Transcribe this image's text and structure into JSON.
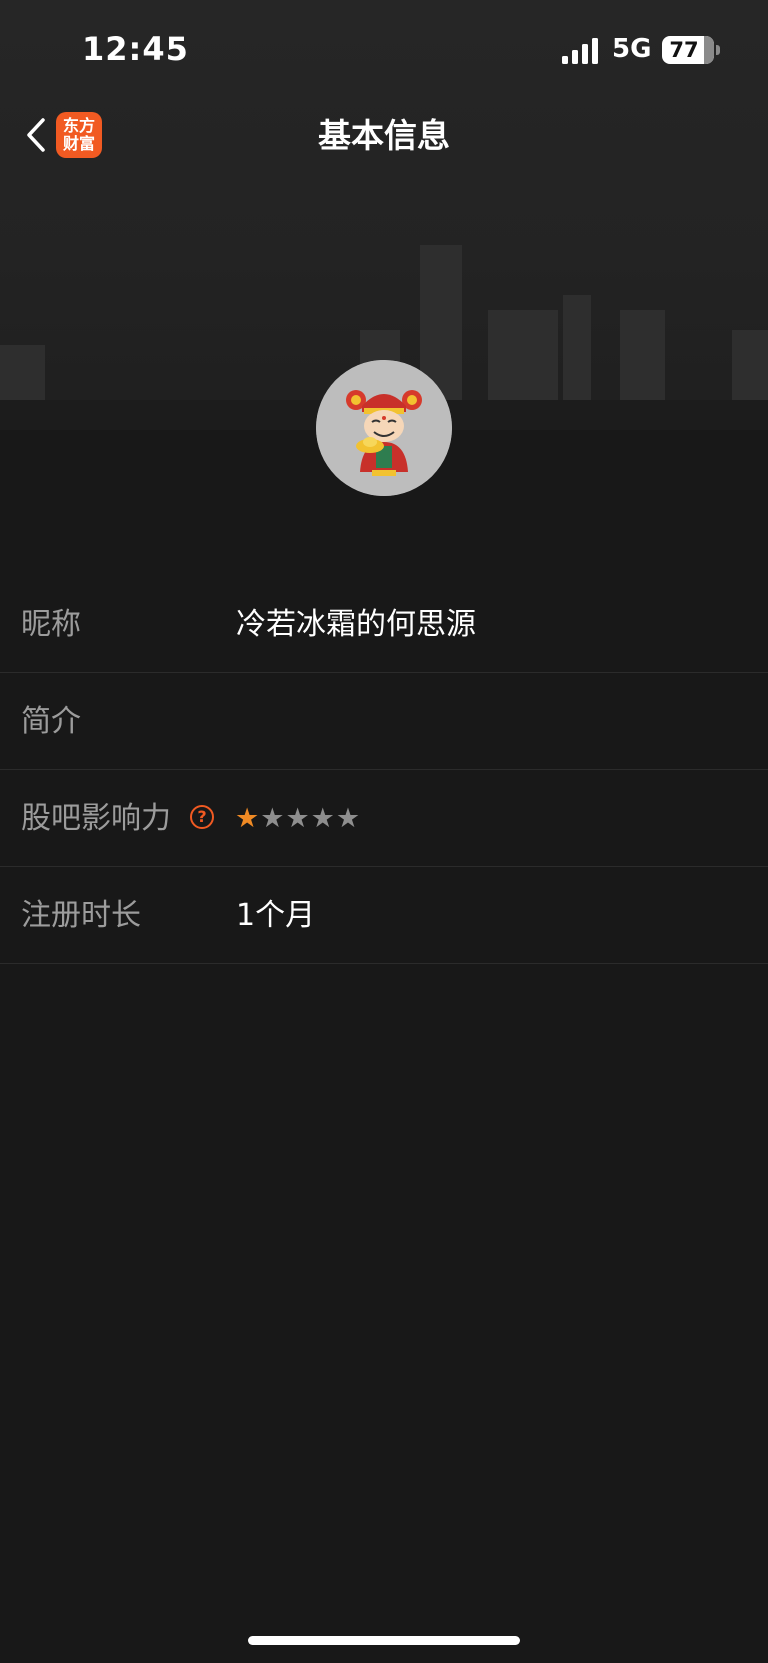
{
  "status_bar": {
    "time": "12:45",
    "network": "5G",
    "battery": "77"
  },
  "nav": {
    "title": "基本信息",
    "logo_line1": "东方",
    "logo_line2": "财富"
  },
  "rows": [
    {
      "label": "昵称",
      "value": "冷若冰霜的何思源"
    },
    {
      "label": "简介",
      "value": ""
    },
    {
      "label": "股吧影响力",
      "help": "?",
      "rating": 1,
      "rating_max": 5
    },
    {
      "label": "注册时长",
      "value": "1个月"
    }
  ],
  "colors": {
    "accent": "#f15a22",
    "star_active": "#f08a24",
    "star_inactive": "#8e8e8e"
  },
  "icons": [
    "back-arrow-icon",
    "help-circle-icon",
    "star-icon"
  ]
}
